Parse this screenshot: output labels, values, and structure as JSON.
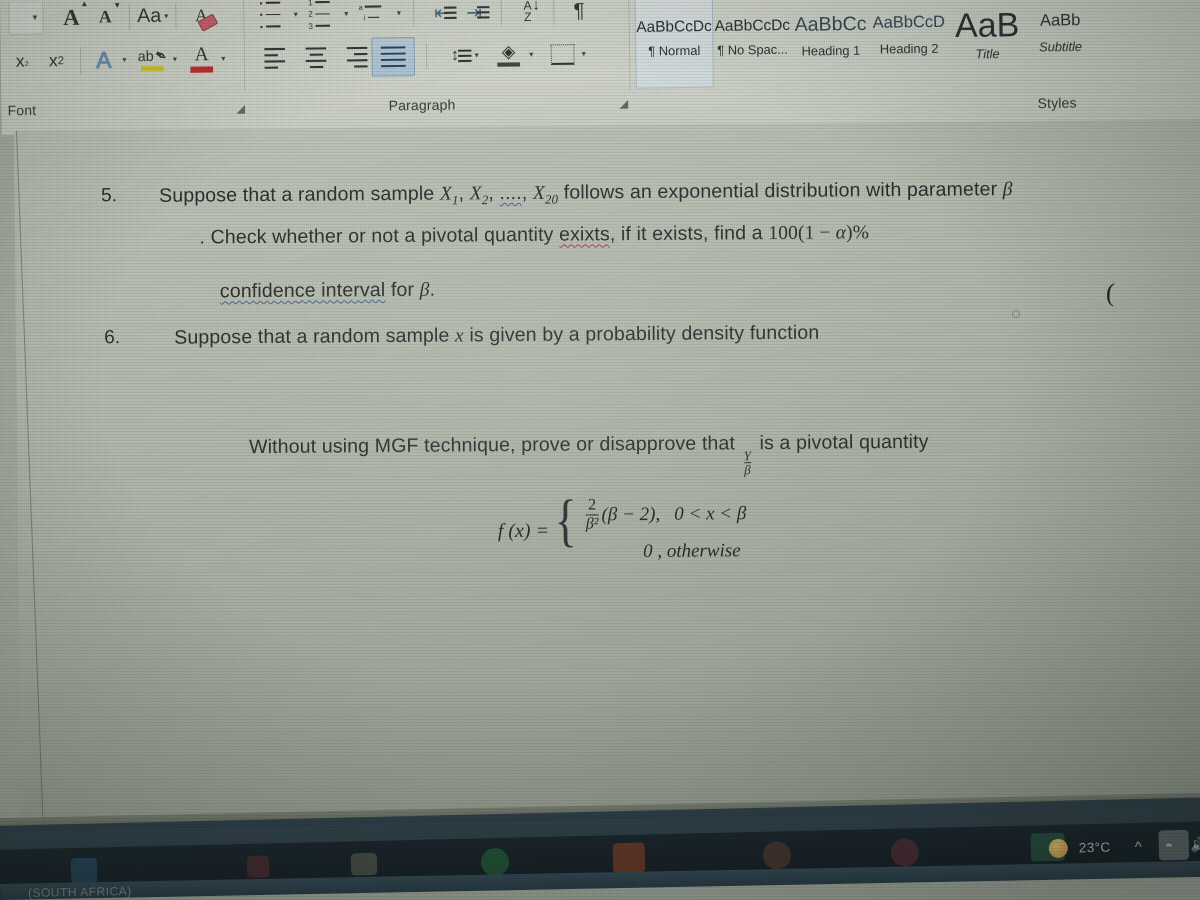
{
  "app": {
    "name": "Microsoft Word",
    "view": "photo-of-laptop-screen"
  },
  "ribbon": {
    "groups": [
      {
        "label": "Font",
        "dialog_launcher": "font-dialog-launcher"
      },
      {
        "label": "Paragraph",
        "dialog_launcher": "paragraph-dialog-launcher"
      },
      {
        "label": "Styles",
        "dialog_launcher": null
      }
    ],
    "font_group": {
      "label": "Font",
      "row1": [
        {
          "name": "font-size-dropdown",
          "glyph": "▾"
        },
        {
          "name": "grow-font-icon",
          "glyph": "A"
        },
        {
          "name": "shrink-font-icon",
          "glyph": "A"
        },
        {
          "name": "change-case-icon",
          "glyph": "Aa"
        },
        {
          "name": "clear-formatting-icon",
          "glyph": "A"
        }
      ],
      "row2": [
        {
          "name": "subscript-icon",
          "glyph": "x"
        },
        {
          "name": "superscript-icon",
          "glyph": "x"
        },
        {
          "name": "text-effects-icon",
          "glyph": "A"
        },
        {
          "name": "text-highlight-color-icon",
          "glyph": "ab"
        },
        {
          "name": "font-color-icon",
          "glyph": "A"
        }
      ]
    },
    "paragraph_group": {
      "label": "Paragraph",
      "row1": [
        {
          "name": "bullets-icon"
        },
        {
          "name": "numbering-icon"
        },
        {
          "name": "multilevel-list-icon"
        },
        {
          "name": "decrease-indent-icon"
        },
        {
          "name": "increase-indent-icon"
        },
        {
          "name": "sort-icon",
          "glyph": "A\nZ"
        },
        {
          "name": "show-formatting-marks-icon",
          "glyph": "¶"
        }
      ],
      "row2": [
        {
          "name": "align-left-icon"
        },
        {
          "name": "align-center-icon"
        },
        {
          "name": "align-right-icon"
        },
        {
          "name": "justify-icon",
          "selected": true
        },
        {
          "name": "line-spacing-icon"
        },
        {
          "name": "shading-icon"
        },
        {
          "name": "borders-icon"
        }
      ]
    },
    "styles_group": {
      "label": "Styles",
      "tiles": [
        {
          "preview": "AaBbCcDc",
          "name": "¶ Normal",
          "selected": true
        },
        {
          "preview": "AaBbCcDc",
          "name": "¶ No Spac...",
          "selected": false
        },
        {
          "preview": "AaBbCс",
          "name": "Heading 1",
          "selected": false
        },
        {
          "preview": "AaBbCcD",
          "name": "Heading 2",
          "selected": false
        },
        {
          "preview": "AaB",
          "name": "Title",
          "selected": false
        },
        {
          "preview": "AaBb",
          "name": "Subtitle",
          "selected": false
        }
      ]
    }
  },
  "document": {
    "items": [
      {
        "number": "5.",
        "lines": [
          {
            "segments": [
              {
                "t": "Suppose that a random sample "
              },
              {
                "t": "X",
                "style": "italic"
              },
              {
                "t": "1",
                "style": "sub"
              },
              {
                "t": ", "
              },
              {
                "t": "X",
                "style": "italic"
              },
              {
                "t": "2",
                "style": "sub"
              },
              {
                "t": ", "
              },
              {
                "t": "....",
                "style": "spell-blue"
              },
              {
                "t": ", "
              },
              {
                "t": "X",
                "style": "italic"
              },
              {
                "t": "20",
                "style": "sub"
              },
              {
                "t": " follows an exponential distribution with parameter "
              },
              {
                "t": "β",
                "style": "italic"
              }
            ]
          },
          {
            "segments": [
              {
                "t": ". Check whether or not a pivotal quantity "
              },
              {
                "t": "exixts",
                "style": "spell-red"
              },
              {
                "t": ", if it exists, find a 100(1 − α)%"
              }
            ]
          },
          {
            "segments": [
              {
                "t": "confidence interval",
                "style": "spell-blue"
              },
              {
                "t": " for "
              },
              {
                "t": "β",
                "style": "italic"
              },
              {
                "t": "."
              }
            ]
          }
        ]
      },
      {
        "number": "6.",
        "lines": [
          {
            "segments": [
              {
                "t": "Suppose that a random sample "
              },
              {
                "t": "x",
                "style": "italic"
              },
              {
                "t": " is given by  a probability density function"
              }
            ]
          }
        ]
      }
    ],
    "formula": {
      "lhs": "f (x) =",
      "case1": {
        "fraction_numerator": "2",
        "fraction_denominator": "β²",
        "expression": "(β − 2),",
        "condition": "0 < x < β"
      },
      "case2": "0 , otherwise"
    },
    "closing_line": {
      "before": "Without using MGF technique, prove or disapprove that ",
      "fraction_numerator": "Y",
      "fraction_denominator": "β",
      "after": " is a pivotal quantity"
    },
    "stray_character": "("
  },
  "taskbar": {
    "weather": {
      "temperature": "23°C",
      "icon": "sun-icon"
    },
    "tray_icons": [
      "show-hidden-icons-chevron",
      "wifi-icon",
      "volume-icon",
      "battery-icon"
    ],
    "pinned_icons": [
      "windows-start-icon",
      "search-icon",
      "file-explorer-icon",
      "whatsapp-icon",
      "office-icon",
      "chrome-icon",
      "app-icon",
      "media-player-icon",
      "word-icon"
    ],
    "bottom_strip_label": "(SOUTH AFRICA)"
  },
  "colors": {
    "ribbon_bg": "#e6e9e1",
    "page_bg": "#c8ccc2",
    "text": "#2e3234",
    "accent_selected": "#b9cfe3",
    "taskbar": "#15202a",
    "spell_red": "#b24a52",
    "spell_blue": "#4b6ea8",
    "font_color_swatch": "#d8303a",
    "highlight_swatch": "#e8d832"
  }
}
